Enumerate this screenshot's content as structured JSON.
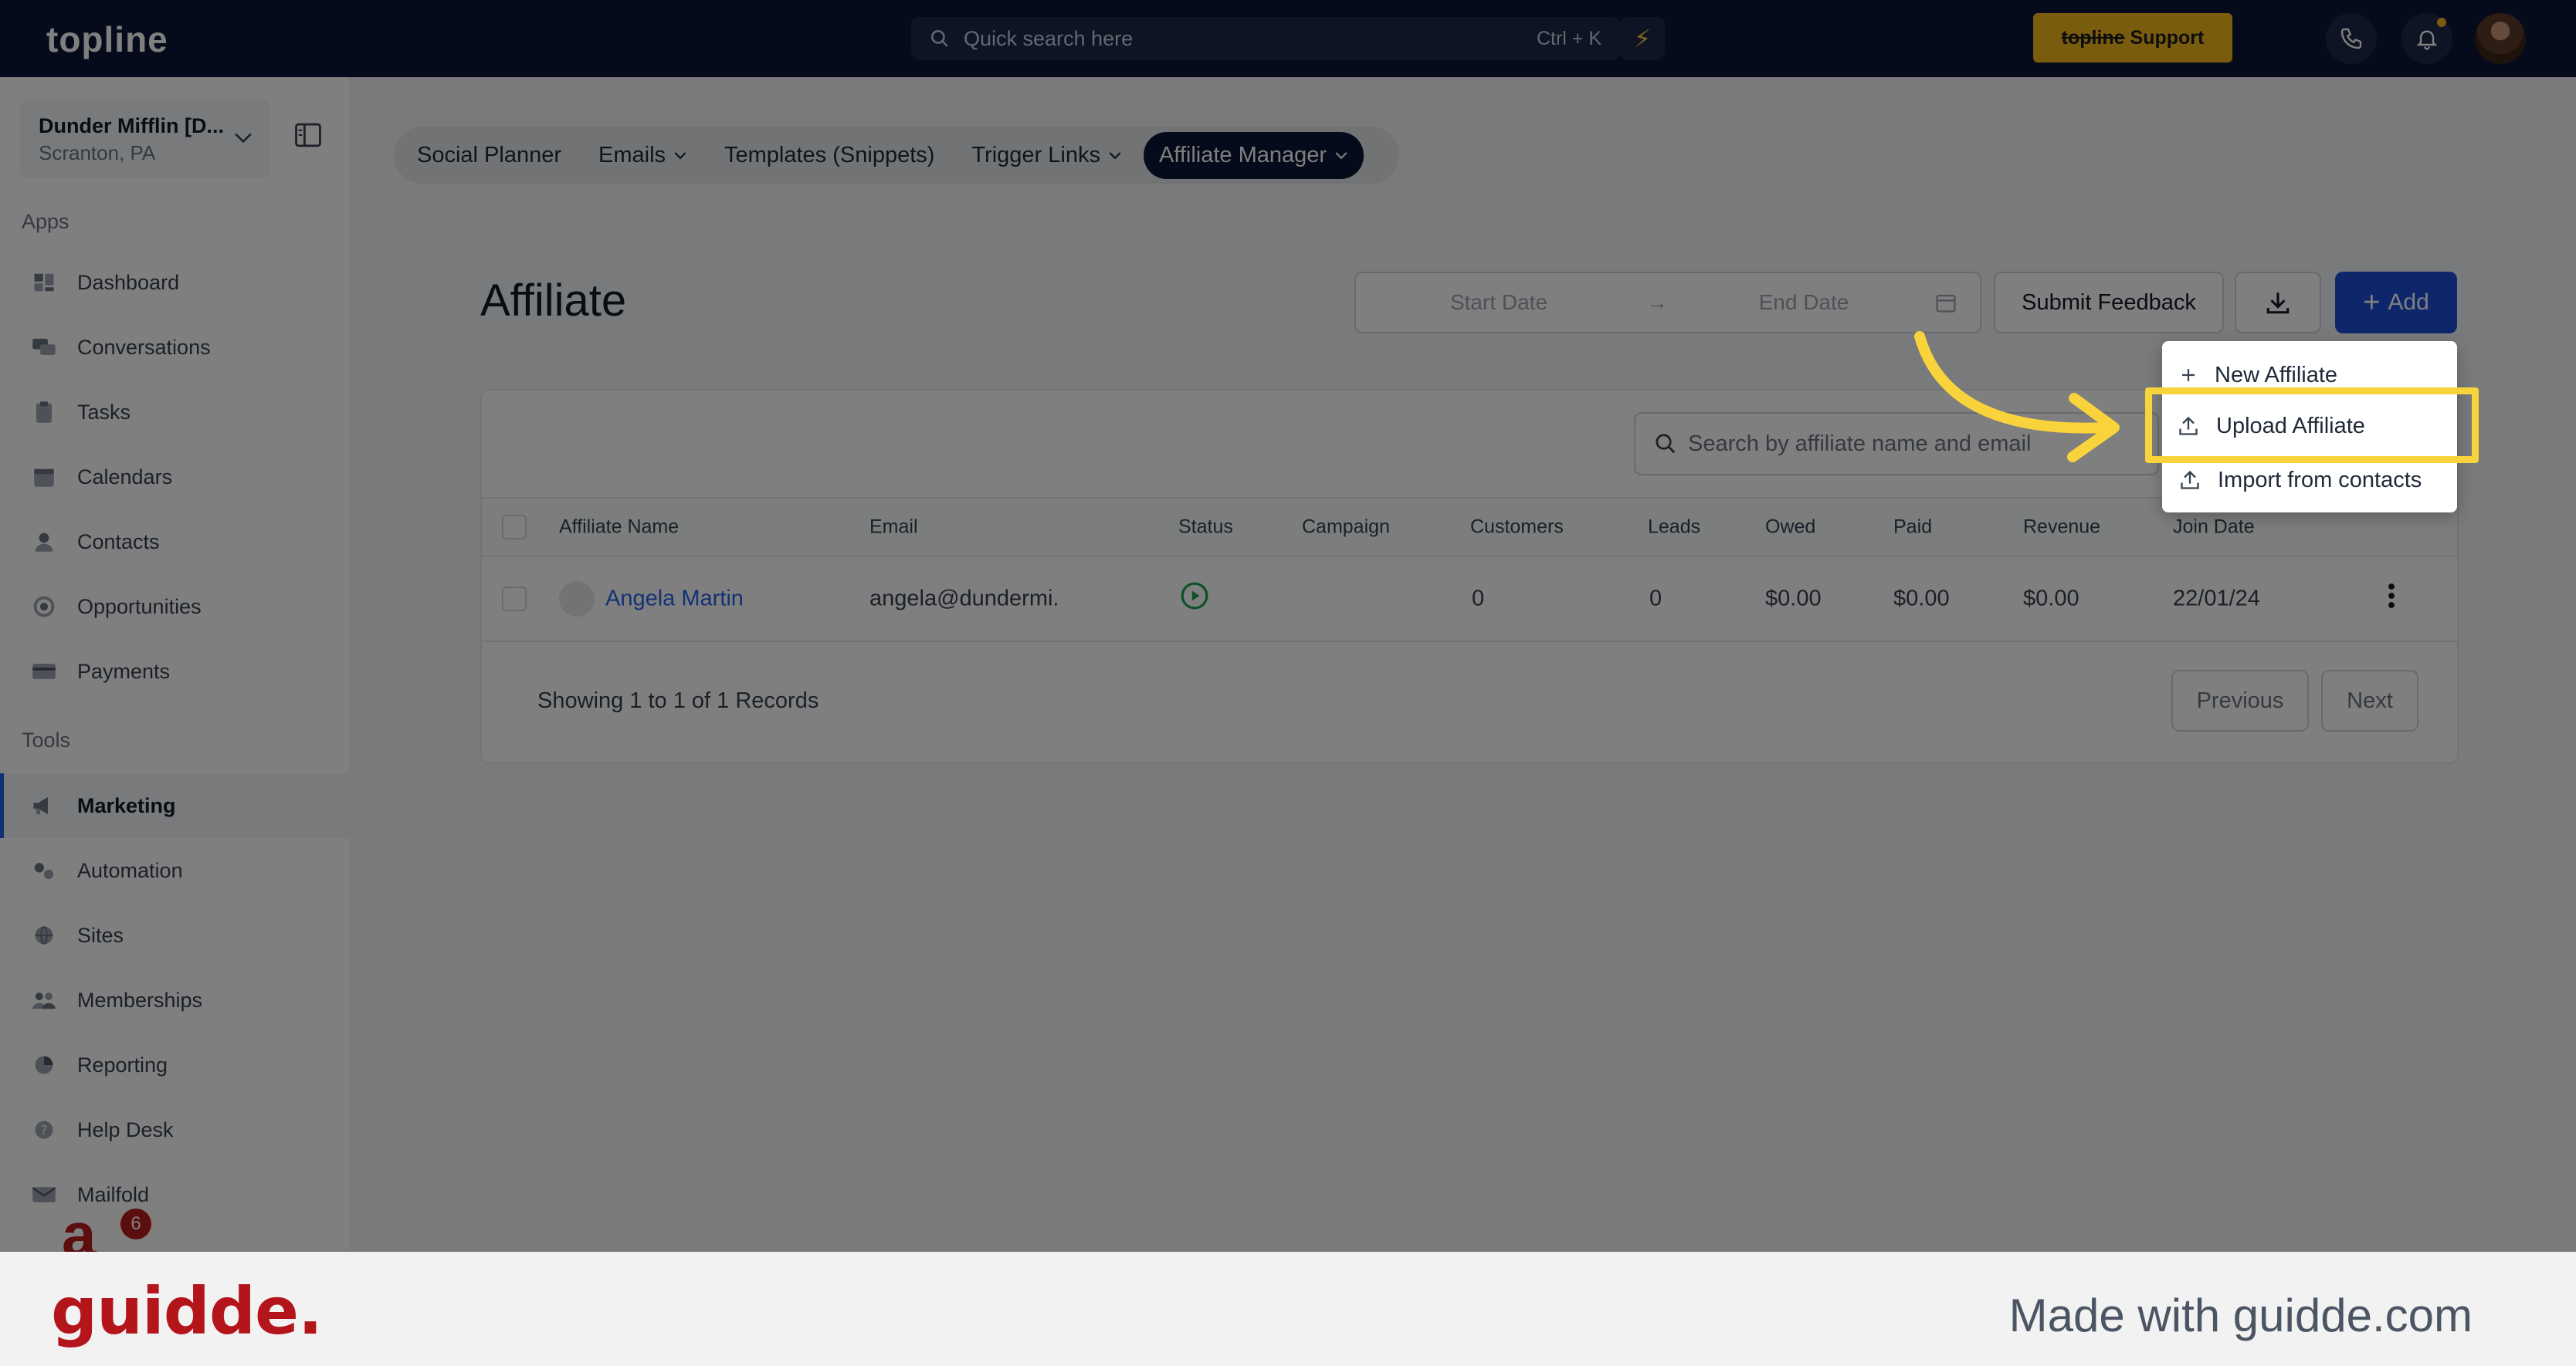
{
  "topbar": {
    "logo": "topline",
    "search_placeholder": "Quick search here",
    "search_shortcut": "Ctrl + K",
    "support_brand": "topline",
    "support_label": "Support"
  },
  "sidebar": {
    "location_name": "Dunder Mifflin [D...",
    "location_sub": "Scranton, PA",
    "apps_label": "Apps",
    "apps": [
      {
        "label": "Dashboard",
        "icon": "dashboard-icon"
      },
      {
        "label": "Conversations",
        "icon": "chat-icon"
      },
      {
        "label": "Tasks",
        "icon": "clipboard-icon"
      },
      {
        "label": "Calendars",
        "icon": "calendar-icon"
      },
      {
        "label": "Contacts",
        "icon": "person-icon"
      },
      {
        "label": "Opportunities",
        "icon": "target-icon"
      },
      {
        "label": "Payments",
        "icon": "card-icon"
      }
    ],
    "tools_label": "Tools",
    "tools": [
      {
        "label": "Marketing",
        "icon": "megaphone-icon",
        "active": true
      },
      {
        "label": "Automation",
        "icon": "gears-icon"
      },
      {
        "label": "Sites",
        "icon": "globe-icon"
      },
      {
        "label": "Memberships",
        "icon": "people-icon"
      },
      {
        "label": "Reporting",
        "icon": "pie-chart-icon"
      },
      {
        "label": "Help Desk",
        "icon": "help-icon"
      },
      {
        "label": "Mailfold",
        "icon": "mail-icon"
      }
    ],
    "badge_count": "6"
  },
  "tabs": [
    {
      "label": "Social Planner",
      "dropdown": false
    },
    {
      "label": "Emails",
      "dropdown": true
    },
    {
      "label": "Templates (Snippets)",
      "dropdown": false
    },
    {
      "label": "Trigger Links",
      "dropdown": true
    },
    {
      "label": "Affiliate Manager",
      "dropdown": true,
      "active": true
    }
  ],
  "page": {
    "title": "Affiliate",
    "start_date_placeholder": "Start Date",
    "end_date_placeholder": "End Date",
    "submit_feedback": "Submit Feedback",
    "add_label": "Add",
    "search_placeholder": "Search by affiliate name and email"
  },
  "dropdown": {
    "items": [
      {
        "label": "New Affiliate",
        "icon": "plus-icon"
      },
      {
        "label": "Upload Affiliate",
        "icon": "upload-icon"
      },
      {
        "label": "Import from contacts",
        "icon": "upload-icon"
      }
    ]
  },
  "table": {
    "columns": [
      "Affiliate Name",
      "Email",
      "Status",
      "Campaign",
      "Customers",
      "Leads",
      "Owed",
      "Paid",
      "Revenue",
      "Join Date"
    ],
    "rows": [
      {
        "name": "Angela Martin",
        "email": "angela@dundermi.",
        "status": "active",
        "campaign": "",
        "customers": "0",
        "leads": "0",
        "owed": "$0.00",
        "paid": "$0.00",
        "revenue": "$0.00",
        "join_date": "22/01/24"
      }
    ],
    "footer": "Showing 1 to 1 of 1 Records",
    "prev": "Previous",
    "next": "Next"
  },
  "banner": {
    "logo": "guidde.",
    "made_with": "Made with guidde.com"
  },
  "colors": {
    "topbar": "#0b1735",
    "primary": "#1d4ed8",
    "support": "#f5b81c",
    "highlight": "#f9d33b",
    "brand_red": "#b3151b"
  }
}
